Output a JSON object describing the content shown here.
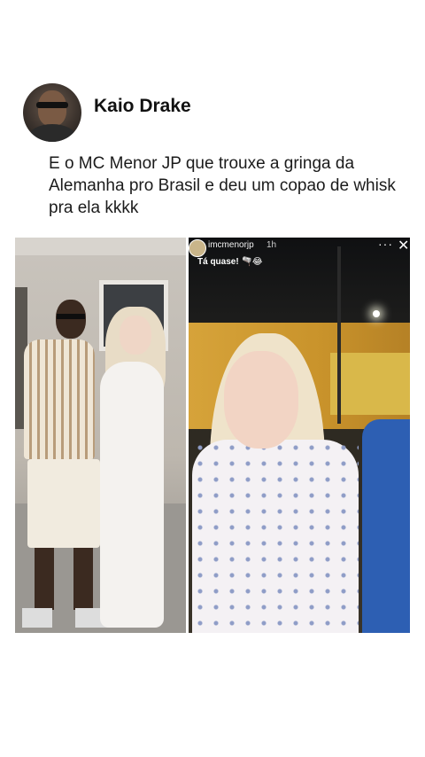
{
  "post": {
    "author_name": "Kaio Drake",
    "text": "E o MC Menor JP que trouxe a gringa da Alemanha pro Brasil e deu um copao de whisk pra ela kkkk"
  },
  "story": {
    "username": "imcmenorjp",
    "verified_icon": "verified-badge-icon",
    "time": "1h",
    "more_label": "···",
    "close_label": "✕",
    "caption": "Tá quase! 🫗😂"
  }
}
